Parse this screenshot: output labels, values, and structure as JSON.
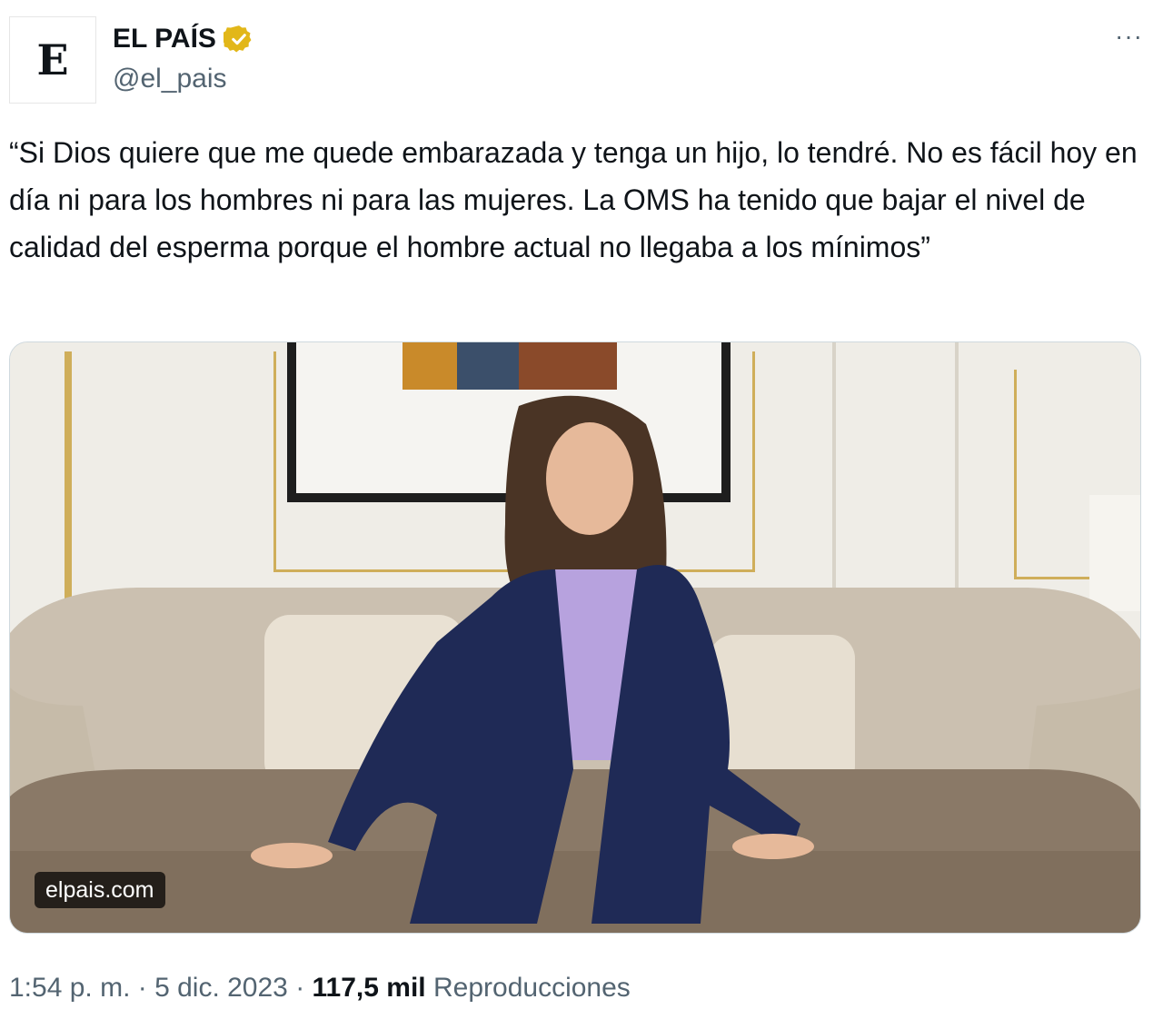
{
  "account": {
    "avatar_letter": "E",
    "display_name": "EL PAÍS",
    "handle": "@el_pais",
    "verified_color": "#e2b719"
  },
  "menu": {
    "more_label": "···"
  },
  "tweet": {
    "text": "“Si Dios quiere que me quede embarazada y tenga un hijo, lo tendré. No es fácil hoy en día ni para los hombres ni para las mujeres. La OMS ha tenido que bajar el nivel de calidad del esperma porque el hombre actual no llegaba a los mínimos”"
  },
  "media": {
    "domain_label": "elpais.com"
  },
  "meta": {
    "time": "1:54 p. m.",
    "separator": " · ",
    "date": "5 dic. 2023",
    "views_count": "117,5 mil",
    "views_label": "Reproducciones"
  }
}
